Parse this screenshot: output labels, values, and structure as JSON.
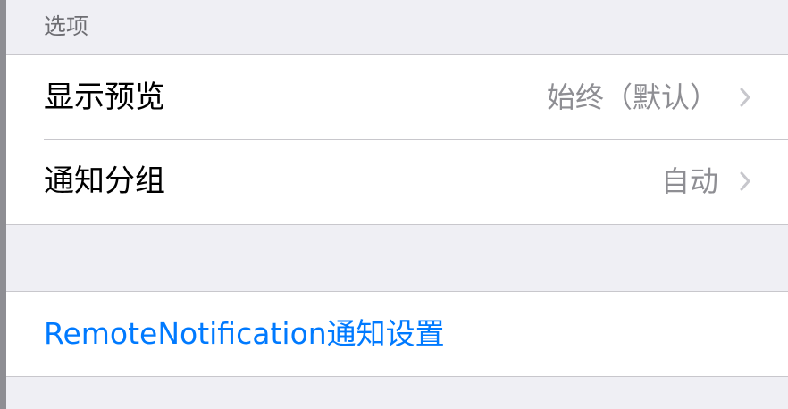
{
  "options_section": {
    "header": "选项",
    "rows": [
      {
        "label": "显示预览",
        "value": "始终（默认）"
      },
      {
        "label": "通知分组",
        "value": "自动"
      }
    ]
  },
  "remote_section": {
    "link_label": "RemoteNotification通知设置"
  },
  "colors": {
    "background": "#efeff4",
    "cell": "#ffffff",
    "separator": "#c8c7cc",
    "secondary_text": "#8e8e93",
    "link": "#007aff"
  },
  "icons": {
    "disclosure": "chevron-right-icon"
  }
}
